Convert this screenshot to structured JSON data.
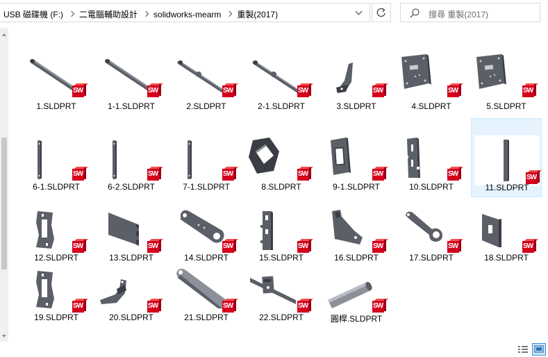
{
  "breadcrumb": [
    "USB 磁碟機 (F:)",
    "二電腦輔助設計",
    "solidworks-mearm",
    "重製(2017)"
  ],
  "search": {
    "placeholder": "搜尋 重製(2017)"
  },
  "files": [
    {
      "name": "1.SLDPRT",
      "shape": "long-arm-a"
    },
    {
      "name": "1-1.SLDPRT",
      "shape": "long-arm-a"
    },
    {
      "name": "2.SLDPRT",
      "shape": "long-arm-b"
    },
    {
      "name": "2-1.SLDPRT",
      "shape": "long-arm-b"
    },
    {
      "name": "3.SLDPRT",
      "shape": "bracket"
    },
    {
      "name": "4.SLDPRT",
      "shape": "plate-holes"
    },
    {
      "name": "5.SLDPRT",
      "shape": "plate-holes"
    },
    {
      "name": "6-1.SLDPRT",
      "shape": "thin-bar"
    },
    {
      "name": "6-2.SLDPRT",
      "shape": "thin-bar"
    },
    {
      "name": "7-1.SLDPRT",
      "shape": "thin-bar"
    },
    {
      "name": "8.SLDPRT",
      "shape": "diamond-plate"
    },
    {
      "name": "9-1.SLDPRT",
      "shape": "frame-plate"
    },
    {
      "name": "10.SLDPRT",
      "shape": "slotted-plate"
    },
    {
      "name": "11.SLDPRT",
      "shape": "flat-bar",
      "selected": true
    },
    {
      "name": "12.SLDPRT",
      "shape": "clip-frame"
    },
    {
      "name": "13.SLDPRT",
      "shape": "tab-plate"
    },
    {
      "name": "14.SLDPRT",
      "shape": "link"
    },
    {
      "name": "15.SLDPRT",
      "shape": "narrow-slot"
    },
    {
      "name": "16.SLDPRT",
      "shape": "hook-plate"
    },
    {
      "name": "17.SLDPRT",
      "shape": "wrench"
    },
    {
      "name": "18.SLDPRT",
      "shape": "square-plate"
    },
    {
      "name": "19.SLDPRT",
      "shape": "clip-frame"
    },
    {
      "name": "20.SLDPRT",
      "shape": "small-bracket"
    },
    {
      "name": "21.SLDPRT",
      "shape": "link-long"
    },
    {
      "name": "22.SLDPRT",
      "shape": "slider"
    },
    {
      "name": "圓桿.SLDPRT",
      "shape": "rod"
    }
  ],
  "icons": {
    "file_type": "solidworks-part-icon",
    "sw_label": "SW"
  },
  "colors": {
    "selection_bg": "#e5f3ff",
    "selection_border": "#cce8ff",
    "sw_red": "#d5001c",
    "part_gray": "#5a5e66"
  }
}
